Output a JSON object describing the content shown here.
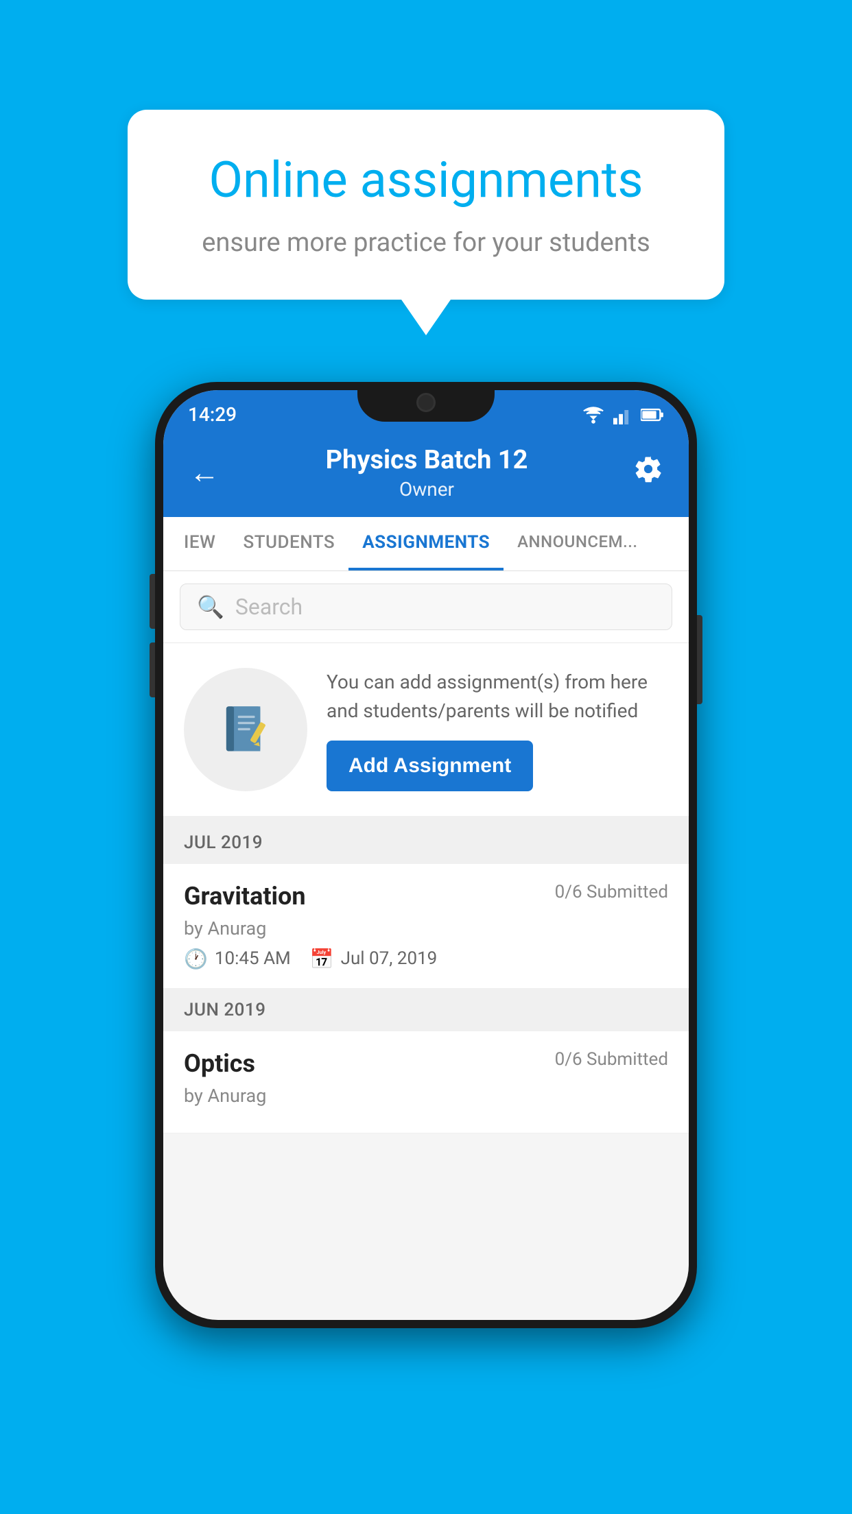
{
  "background_color": "#00AEEF",
  "bubble": {
    "title": "Online assignments",
    "subtitle": "ensure more practice for your students"
  },
  "status_bar": {
    "time": "14:29"
  },
  "header": {
    "title": "Physics Batch 12",
    "subtitle": "Owner"
  },
  "tabs": [
    {
      "label": "IEW",
      "active": false
    },
    {
      "label": "STUDENTS",
      "active": false
    },
    {
      "label": "ASSIGNMENTS",
      "active": true
    },
    {
      "label": "ANNOUNCEM...",
      "active": false
    }
  ],
  "search": {
    "placeholder": "Search"
  },
  "promo": {
    "text": "You can add assignment(s) from here and students/parents will be notified",
    "button_label": "Add Assignment"
  },
  "sections": [
    {
      "month_label": "JUL 2019",
      "assignments": [
        {
          "name": "Gravitation",
          "submitted": "0/6 Submitted",
          "by": "by Anurag",
          "time": "10:45 AM",
          "date": "Jul 07, 2019"
        }
      ]
    },
    {
      "month_label": "JUN 2019",
      "assignments": [
        {
          "name": "Optics",
          "submitted": "0/6 Submitted",
          "by": "by Anurag",
          "time": "",
          "date": ""
        }
      ]
    }
  ]
}
